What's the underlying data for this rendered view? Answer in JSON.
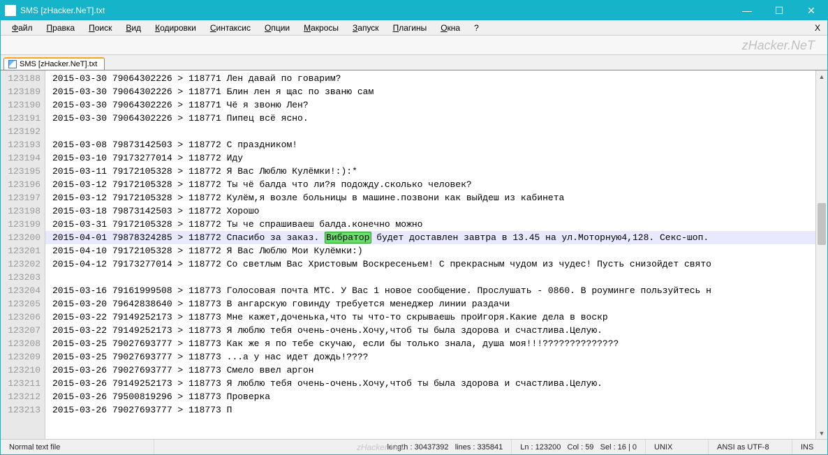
{
  "title": "SMS [zHacker.NeT].txt",
  "watermark": "zHacker.NeT",
  "menu": {
    "items": [
      "Файл",
      "Правка",
      "Поиск",
      "Вид",
      "Кодировки",
      "Синтаксис",
      "Опции",
      "Макросы",
      "Запуск",
      "Плагины",
      "Окна",
      "?"
    ]
  },
  "tab": {
    "label": "SMS [zHacker.NeT].txt"
  },
  "lines": [
    {
      "n": "123188",
      "t": "2015-03-30 79064302226 > 118771 Лен давай по говарим?"
    },
    {
      "n": "123189",
      "t": "2015-03-30 79064302226 > 118771 Блин лен я щас по званю сам"
    },
    {
      "n": "123190",
      "t": "2015-03-30 79064302226 > 118771 Чё я звоню Лен?"
    },
    {
      "n": "123191",
      "t": "2015-03-30 79064302226 > 118771 Пипец всё ясно."
    },
    {
      "n": "123192",
      "t": ""
    },
    {
      "n": "123193",
      "t": "2015-03-08 79873142503 > 118772 С праздником!"
    },
    {
      "n": "123194",
      "t": "2015-03-10 79173277014 > 118772 Иду"
    },
    {
      "n": "123195",
      "t": "2015-03-11 79172105328 > 118772 Я Вас Люблю Кулёмки!:):*"
    },
    {
      "n": "123196",
      "t": "2015-03-12 79172105328 > 118772 Ты чё балда что ли?я подожду.сколько человек?"
    },
    {
      "n": "123197",
      "t": "2015-03-12 79172105328 > 118772 Кулём,я возле больницы в машине.позвони как выйдеш из кабинета"
    },
    {
      "n": "123198",
      "t": "2015-03-18 79873142503 > 118772 Хорошо"
    },
    {
      "n": "123199",
      "t": "2015-03-31 79172105328 > 118772 Ты че спрашиваеш балда.конечно можно"
    },
    {
      "n": "123200",
      "pre": "2015-04-01 79878324285 > 118772 Спасибо за заказ. ",
      "hl": "Вибратор",
      "post": " будет доставлен завтра в 13.45 на ул.Моторную4,128. Секс-шоп.",
      "current": true
    },
    {
      "n": "123201",
      "t": "2015-04-10 79172105328 > 118772 Я Вас Люблю Мои Кулёмки:)"
    },
    {
      "n": "123202",
      "t": "2015-04-12 79173277014 > 118772 Со светлым Вас Христовым Воскресеньем! С прекрасным чудом из чудес! Пусть снизойдет свято"
    },
    {
      "n": "123203",
      "t": ""
    },
    {
      "n": "123204",
      "t": "2015-03-16 79161999508 > 118773 Голосовая почта МТС. У Вас 1 новое сообщение. Прослушать - 0860. В роуминге пользуйтесь н"
    },
    {
      "n": "123205",
      "t": "2015-03-20 79642838640 > 118773 В ангарскую говинду требуется менеджер линии раздачи"
    },
    {
      "n": "123206",
      "t": "2015-03-22 79149252173 > 118773 Мне кажет,доченька,что ты что-то скрываешь проИгоря.Какие дела в воскр"
    },
    {
      "n": "123207",
      "t": "2015-03-22 79149252173 > 118773 Я люблю тебя очень-очень.Хочу,чтоб ты была здорова и счастлива.Целую."
    },
    {
      "n": "123208",
      "t": "2015-03-25 79027693777 > 118773 Как же я по тебе скучаю, если бы только знала, душа моя!!!??????????????"
    },
    {
      "n": "123209",
      "t": "2015-03-25 79027693777 > 118773 ...а у нас идет дождь!????"
    },
    {
      "n": "123210",
      "t": "2015-03-26 79027693777 > 118773 Смело ввел аргон"
    },
    {
      "n": "123211",
      "t": "2015-03-26 79149252173 > 118773 Я люблю тебя очень-очень.Хочу,чтоб ты была здорова и счастлива.Целую."
    },
    {
      "n": "123212",
      "t": "2015-03-26 79500819296 > 118773 Проверка"
    },
    {
      "n": "123213",
      "t": "2015-03-26 79027693777 > 118773 П"
    }
  ],
  "status": {
    "type": "Normal text file",
    "length_label": "length : 30437392",
    "lines_label": "lines : 335841",
    "ln_label": "Ln : 123200",
    "col_label": "Col : 59",
    "sel_label": "Sel : 16 | 0",
    "eol": "UNIX",
    "encoding": "ANSI as UTF-8",
    "ins": "INS"
  },
  "win": {
    "minimize": "—",
    "maximize": "☐",
    "close": "✕"
  },
  "x_close": "X"
}
